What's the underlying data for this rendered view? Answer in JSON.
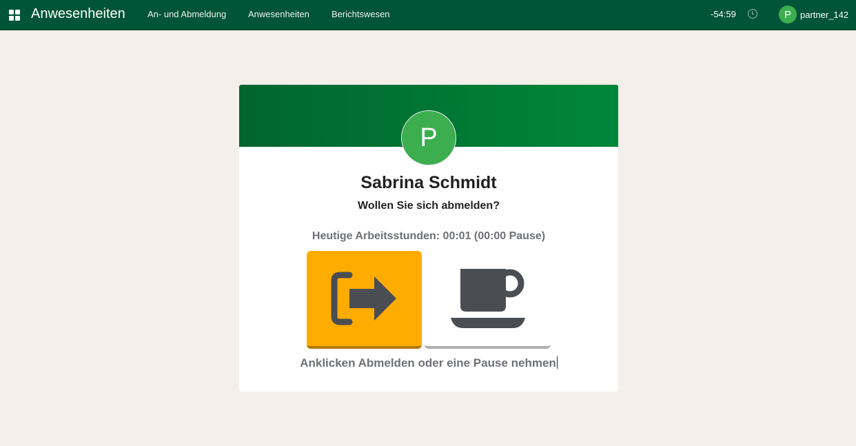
{
  "navbar": {
    "app_title": "Anwesenheiten",
    "apps_icon": "apps-grid-icon",
    "menu": [
      {
        "label": "An- und Abmeldung"
      },
      {
        "label": "Anwesenheiten"
      },
      {
        "label": "Berichtswesen"
      }
    ],
    "timer": "-54:59",
    "clock_icon": "clock-icon",
    "user": {
      "initial": "P",
      "name": "partner_142"
    },
    "colors": {
      "background": "#005437"
    }
  },
  "card": {
    "avatar_initial": "P",
    "employee_name": "Sabrina Schmidt",
    "question": "Wollen Sie sich abmelden?",
    "hours_text": "Heutige Arbeitsstunden: 00:01 (00:00 Pause)",
    "checkout_button": {
      "icon": "sign-out-icon",
      "color": "#ffac00"
    },
    "break_button": {
      "icon": "coffee-cup-icon",
      "color": "#ffffff"
    },
    "hint": "Anklicken Abmelden oder eine Pause nehmen",
    "colors": {
      "header_start": "#00652e",
      "header_end": "#00873a",
      "avatar": "#3cae4f",
      "icon": "#4a4d52"
    }
  }
}
